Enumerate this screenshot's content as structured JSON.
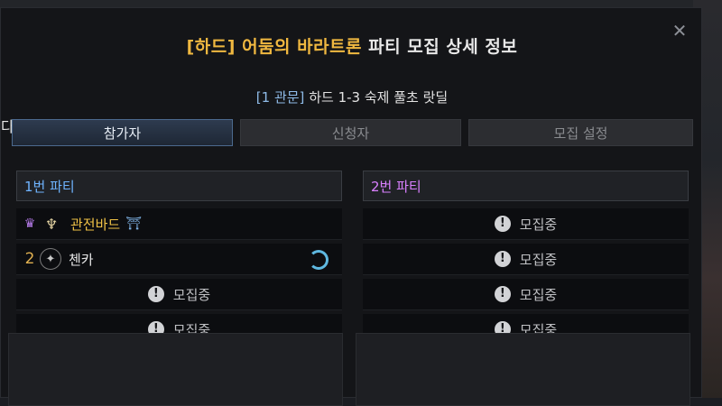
{
  "dialog": {
    "title_highlight": "[하드] 어둠의 바라트론",
    "title_rest": "파티 모집 상세 정보",
    "subtitle_highlight": "[1 관문]",
    "subtitle_rest": "하드 1-3 숙제 풀초 랏딜",
    "left_fragment": "다."
  },
  "tabs": [
    {
      "label": "참가자",
      "active": true
    },
    {
      "label": "신청자",
      "active": false
    },
    {
      "label": "모집 설정",
      "active": false
    }
  ],
  "parties": [
    {
      "title": "1번 파티",
      "members": [
        {
          "indicator": "crown-icon",
          "class_icon": "lyre-icon",
          "name": "관전바드",
          "badge": "gate-icon"
        },
        {
          "indicator": "2",
          "class_icon": "compass-icon",
          "name": "첸카",
          "status": "ring-icon"
        }
      ],
      "recruit_slots": [
        "모집중",
        "모집중"
      ]
    },
    {
      "title": "2번 파티",
      "members": [],
      "recruit_slots": [
        "모집중",
        "모집중",
        "모집중",
        "모집중"
      ]
    }
  ],
  "colors": {
    "accent_gold": "#f0b840",
    "party1": "#6fb4ff",
    "party2": "#d980ff",
    "active_tab": "#2e3b4f"
  }
}
